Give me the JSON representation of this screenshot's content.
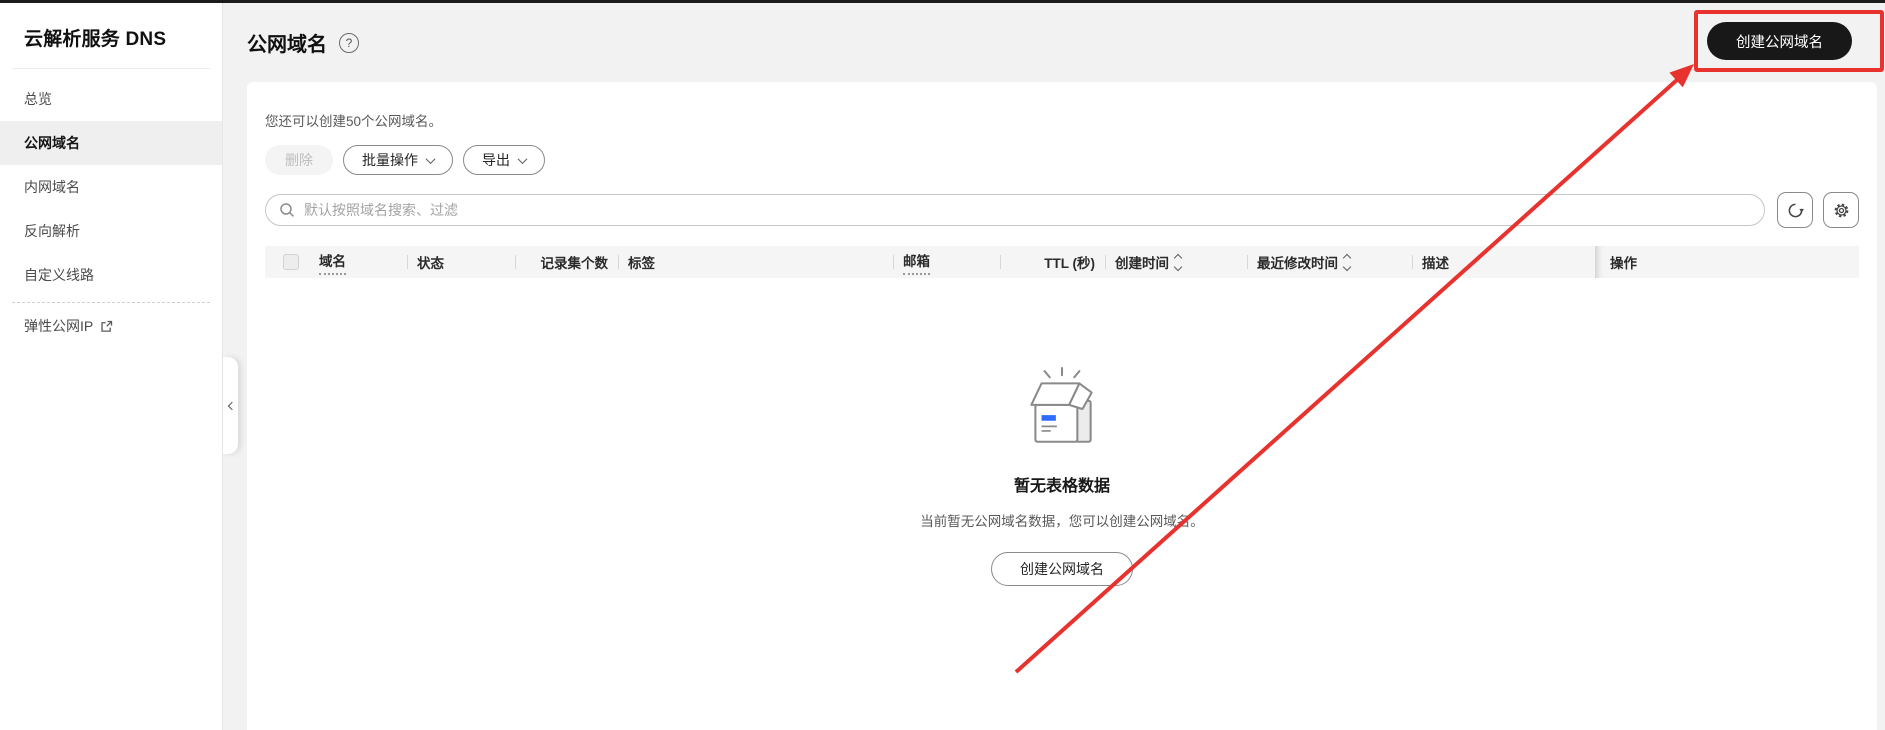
{
  "sidebar": {
    "title": "云解析服务 DNS",
    "items": [
      {
        "label": "总览",
        "active": false
      },
      {
        "label": "公网域名",
        "active": true
      },
      {
        "label": "内网域名",
        "active": false
      },
      {
        "label": "反向解析",
        "active": false
      },
      {
        "label": "自定义线路",
        "active": false
      }
    ],
    "external_item": {
      "label": "弹性公网IP"
    }
  },
  "header": {
    "title": "公网域名",
    "help_icon": "?",
    "create_button": "创建公网域名"
  },
  "toolbar": {
    "quota_text": "您还可以创建50个公网域名。",
    "delete_label": "删除",
    "batch_label": "批量操作",
    "export_label": "导出"
  },
  "search": {
    "placeholder": "默认按照域名搜索、过滤"
  },
  "table": {
    "columns": [
      {
        "label": "域名"
      },
      {
        "label": "状态"
      },
      {
        "label": "记录集个数"
      },
      {
        "label": "标签"
      },
      {
        "label": "邮箱"
      },
      {
        "label": "TTL (秒)"
      },
      {
        "label": "创建时间"
      },
      {
        "label": "最近修改时间"
      },
      {
        "label": "描述"
      },
      {
        "label": "操作"
      }
    ]
  },
  "empty_state": {
    "title": "暂无表格数据",
    "description": "当前暂无公网域名数据，您可以创建公网域名。",
    "button": "创建公网域名"
  },
  "icons": {
    "search": "magnifier",
    "refresh": "circular-arrow",
    "settings": "gear",
    "help": "question-circle",
    "external_link": "arrow-out-of-box",
    "collapse": "chevron-left",
    "dropdown": "chevron-down",
    "sort": "up-down-chevrons",
    "empty": "open-box"
  },
  "colors": {
    "annotation_red": "#e8322e",
    "brand_blue": "#2f6bff",
    "primary_button_bg": "#181818",
    "table_header_bg": "#f5f5f5"
  }
}
